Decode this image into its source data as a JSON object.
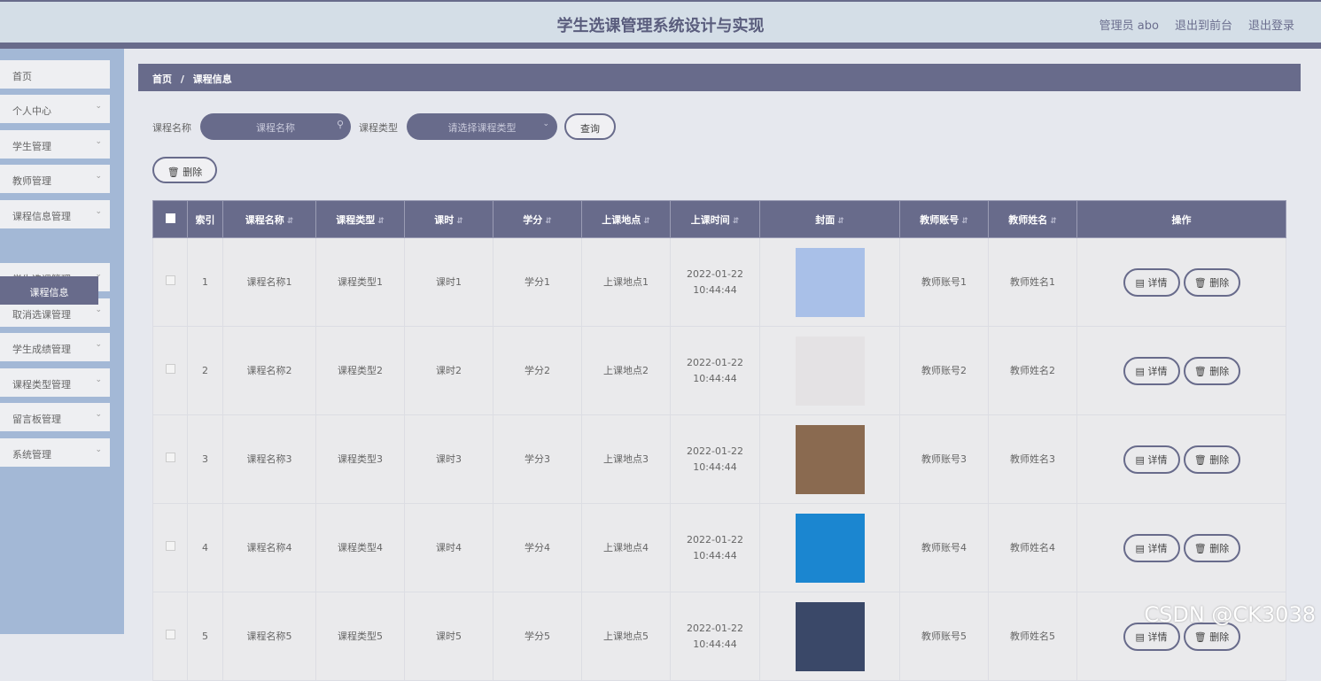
{
  "header": {
    "title": "学生选课管理系统设计与实现",
    "user": "管理员 abo",
    "front": "退出到前台",
    "logout": "退出登录"
  },
  "sidebar": {
    "items": [
      {
        "label": "首页"
      },
      {
        "label": "个人中心"
      },
      {
        "label": "学生管理"
      },
      {
        "label": "教师管理"
      },
      {
        "label": "课程信息管理"
      },
      {
        "label": "学生选课管理"
      },
      {
        "label": "取消选课管理"
      },
      {
        "label": "学生成绩管理"
      },
      {
        "label": "课程类型管理"
      },
      {
        "label": "留言板管理"
      },
      {
        "label": "系统管理"
      }
    ],
    "active_sub": "课程信息"
  },
  "breadcrumb": {
    "home": "首页",
    "sep": "/",
    "current": "课程信息"
  },
  "search": {
    "name_label": "课程名称",
    "name_placeholder": "课程名称",
    "type_label": "课程类型",
    "type_placeholder": "请选择课程类型",
    "query": "查询",
    "delete": "删除"
  },
  "table": {
    "headers": [
      "索引",
      "课程名称",
      "课程类型",
      "课时",
      "学分",
      "上课地点",
      "上课时间",
      "封面",
      "教师账号",
      "教师姓名",
      "操作"
    ],
    "detail": "详情",
    "delete": "删除",
    "rows": [
      {
        "idx": "1",
        "name": "课程名称1",
        "type": "课程类型1",
        "hours": "课时1",
        "credit": "学分1",
        "place": "上课地点1",
        "time": "2022-01-22 10:44:44",
        "acct": "教师账号1",
        "teacher": "教师姓名1",
        "cover_color": "#a9c0e8"
      },
      {
        "idx": "2",
        "name": "课程名称2",
        "type": "课程类型2",
        "hours": "课时2",
        "credit": "学分2",
        "place": "上课地点2",
        "time": "2022-01-22 10:44:44",
        "acct": "教师账号2",
        "teacher": "教师姓名2",
        "cover_color": "#e4e2e4"
      },
      {
        "idx": "3",
        "name": "课程名称3",
        "type": "课程类型3",
        "hours": "课时3",
        "credit": "学分3",
        "place": "上课地点3",
        "time": "2022-01-22 10:44:44",
        "acct": "教师账号3",
        "teacher": "教师姓名3",
        "cover_color": "#8a6a50"
      },
      {
        "idx": "4",
        "name": "课程名称4",
        "type": "课程类型4",
        "hours": "课时4",
        "credit": "学分4",
        "place": "上课地点4",
        "time": "2022-01-22 10:44:44",
        "acct": "教师账号4",
        "teacher": "教师姓名4",
        "cover_color": "#1b86d0"
      },
      {
        "idx": "5",
        "name": "课程名称5",
        "type": "课程类型5",
        "hours": "课时5",
        "credit": "学分5",
        "place": "上课地点5",
        "time": "2022-01-22 10:44:44",
        "acct": "教师账号5",
        "teacher": "教师姓名5",
        "cover_color": "#3a4868"
      }
    ]
  },
  "watermark": "CSDN @CK3038"
}
